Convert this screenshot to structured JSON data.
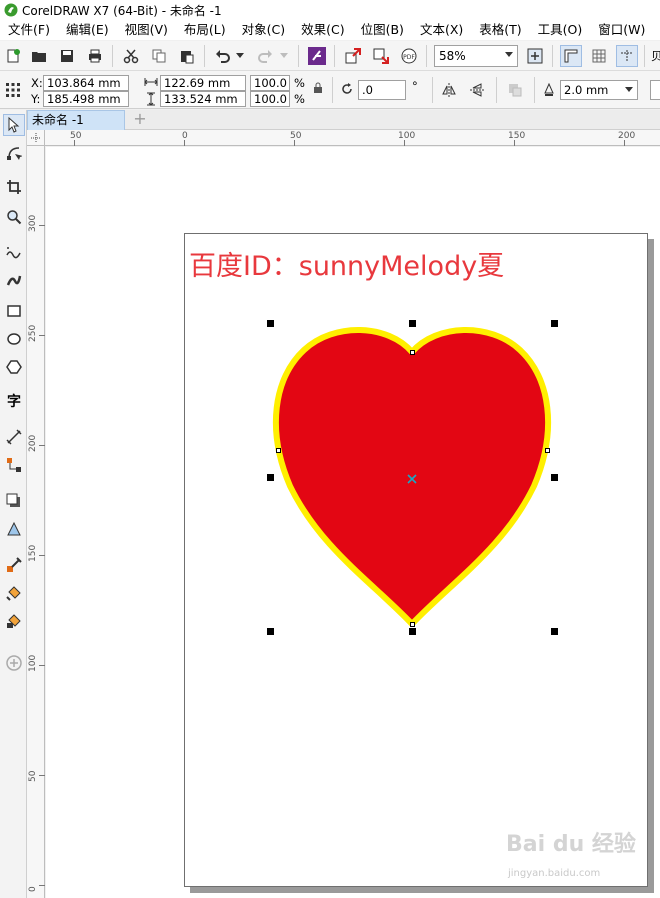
{
  "window": {
    "title": "CorelDRAW X7 (64-Bit) - 未命名 -1"
  },
  "menu": [
    "文件(F)",
    "编辑(E)",
    "视图(V)",
    "布局(L)",
    "对象(C)",
    "效果(C)",
    "位图(B)",
    "文本(X)",
    "表格(T)",
    "工具(O)",
    "窗口(W)"
  ],
  "standard_toolbar": {
    "zoom_level": "58%",
    "cut_off_label": "贝"
  },
  "property_bar": {
    "x_label": "X:",
    "x_value": "103.864 mm",
    "y_label": "Y:",
    "y_value": "185.498 mm",
    "width_value": "122.69 mm",
    "height_value": "133.524 mm",
    "scale_w": "100.0",
    "scale_h": "100.0",
    "percent": "%",
    "rotation_value": ".0",
    "degree": "°",
    "outline_width": "2.0 mm"
  },
  "document_tab": {
    "label": "未命名 -1",
    "add_label": "+"
  },
  "rulers": {
    "horizontal": [
      "50",
      "0",
      "50",
      "100",
      "150",
      "200"
    ],
    "vertical": [
      "300",
      "250",
      "200",
      "150",
      "100",
      "50",
      "0"
    ]
  },
  "page": {
    "text": "百度ID：sunnyMelody夏",
    "heart_fill": "#e30613",
    "heart_outline": "#ffef00",
    "text_color": "#e8383d"
  },
  "watermark": {
    "brand": "Bai du 经验",
    "url": "jingyan.baidu.com"
  }
}
